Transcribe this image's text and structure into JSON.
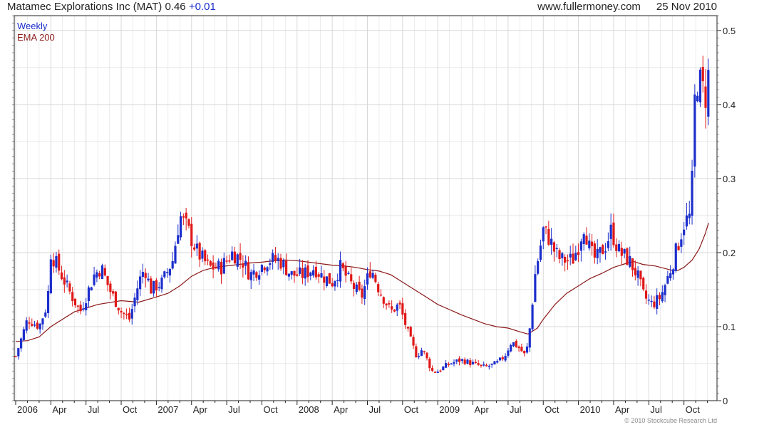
{
  "header": {
    "ticker_text": "Matamec Explorations Inc (MAT) 0.46",
    "change": "+0.01",
    "site": "www.fullermoney.com",
    "date": "25 Nov 2010"
  },
  "legend": {
    "series": "Weekly",
    "ema": "EMA 200"
  },
  "copyright": "© 2010 Stockcube Research Ltd",
  "colors": {
    "up": "#1c2ecc",
    "down": "#e01818",
    "ema": "#8b1a1a",
    "grid": "#d9d9d9",
    "frame": "#222222"
  },
  "chart_data": {
    "type": "candlestick",
    "frequency": "weekly",
    "title": "Matamec Explorations Inc (MAT) 0.46 +0.01",
    "ylim": [
      0,
      0.52
    ],
    "y_ticks": [
      "0",
      "0.1",
      "0.2",
      "0.3",
      "0.4",
      "0.5"
    ],
    "x_labels": [
      "2006",
      "Apr",
      "Jul",
      "Oct",
      "2007",
      "Apr",
      "Jul",
      "Oct",
      "2008",
      "Apr",
      "Jul",
      "Oct",
      "2009",
      "Apr",
      "Jul",
      "Oct",
      "2010",
      "Apr",
      "Jul",
      "Oct"
    ],
    "x_label_months": [
      0,
      3,
      6,
      9,
      12,
      15,
      18,
      21,
      24,
      27,
      30,
      33,
      36,
      39,
      42,
      45,
      48,
      51,
      54,
      57
    ],
    "grid": true,
    "price_anchors": [
      [
        0.0,
        0.06
      ],
      [
        0.3,
        0.075
      ],
      [
        1.0,
        0.11
      ],
      [
        2.0,
        0.1
      ],
      [
        2.7,
        0.13
      ],
      [
        3.0,
        0.2
      ],
      [
        3.6,
        0.18
      ],
      [
        4.5,
        0.15
      ],
      [
        5.5,
        0.12
      ],
      [
        6.0,
        0.14
      ],
      [
        6.7,
        0.17
      ],
      [
        7.3,
        0.18
      ],
      [
        8.0,
        0.15
      ],
      [
        9.0,
        0.12
      ],
      [
        9.7,
        0.11
      ],
      [
        10.5,
        0.16
      ],
      [
        11.0,
        0.18
      ],
      [
        11.5,
        0.15
      ],
      [
        12.5,
        0.16
      ],
      [
        13.4,
        0.19
      ],
      [
        14.0,
        0.25
      ],
      [
        14.7,
        0.23
      ],
      [
        15.5,
        0.2
      ],
      [
        16.5,
        0.18
      ],
      [
        17.5,
        0.18
      ],
      [
        18.5,
        0.2
      ],
      [
        19.3,
        0.19
      ],
      [
        20.0,
        0.17
      ],
      [
        20.8,
        0.18
      ],
      [
        21.5,
        0.19
      ],
      [
        22.5,
        0.19
      ],
      [
        23.5,
        0.17
      ],
      [
        24.5,
        0.17
      ],
      [
        25.5,
        0.18
      ],
      [
        26.0,
        0.17
      ],
      [
        27.0,
        0.16
      ],
      [
        27.7,
        0.18
      ],
      [
        28.5,
        0.16
      ],
      [
        29.5,
        0.14
      ],
      [
        30.3,
        0.18
      ],
      [
        31.0,
        0.15
      ],
      [
        32.0,
        0.12
      ],
      [
        32.7,
        0.13
      ],
      [
        33.5,
        0.09
      ],
      [
        34.2,
        0.06
      ],
      [
        34.7,
        0.07
      ],
      [
        35.5,
        0.04
      ],
      [
        36.0,
        0.04
      ],
      [
        37.0,
        0.05
      ],
      [
        38.0,
        0.055
      ],
      [
        39.0,
        0.05
      ],
      [
        40.0,
        0.045
      ],
      [
        41.0,
        0.05
      ],
      [
        41.7,
        0.06
      ],
      [
        42.3,
        0.08
      ],
      [
        43.0,
        0.07
      ],
      [
        43.5,
        0.06
      ],
      [
        43.8,
        0.09
      ],
      [
        44.3,
        0.17
      ],
      [
        45.0,
        0.23
      ],
      [
        45.5,
        0.22
      ],
      [
        46.0,
        0.2
      ],
      [
        46.5,
        0.19
      ],
      [
        47.5,
        0.19
      ],
      [
        48.0,
        0.21
      ],
      [
        48.5,
        0.24
      ],
      [
        49.0,
        0.2
      ],
      [
        49.5,
        0.19
      ],
      [
        50.3,
        0.21
      ],
      [
        50.8,
        0.23
      ],
      [
        51.5,
        0.2
      ],
      [
        52.3,
        0.19
      ],
      [
        53.0,
        0.17
      ],
      [
        53.6,
        0.14
      ],
      [
        54.3,
        0.13
      ],
      [
        55.0,
        0.14
      ],
      [
        55.7,
        0.17
      ],
      [
        56.3,
        0.2
      ],
      [
        57.0,
        0.24
      ],
      [
        57.6,
        0.25
      ],
      [
        58.0,
        0.44
      ],
      [
        58.3,
        0.43
      ],
      [
        58.8,
        0.41
      ],
      [
        59.1,
        0.44
      ]
    ],
    "ema_200": [
      [
        0.0,
        0.08
      ],
      [
        1.0,
        0.081
      ],
      [
        2.0,
        0.086
      ],
      [
        3.0,
        0.1
      ],
      [
        5.0,
        0.12
      ],
      [
        7.0,
        0.13
      ],
      [
        9.0,
        0.135
      ],
      [
        10.5,
        0.133
      ],
      [
        12.0,
        0.14
      ],
      [
        13.0,
        0.145
      ],
      [
        14.0,
        0.155
      ],
      [
        15.0,
        0.168
      ],
      [
        16.0,
        0.176
      ],
      [
        17.0,
        0.18
      ],
      [
        18.0,
        0.182
      ],
      [
        19.0,
        0.184
      ],
      [
        20.0,
        0.186
      ],
      [
        21.0,
        0.187
      ],
      [
        22.0,
        0.189
      ],
      [
        23.0,
        0.19
      ],
      [
        24.0,
        0.189
      ],
      [
        25.0,
        0.187
      ],
      [
        26.0,
        0.185
      ],
      [
        27.0,
        0.183
      ],
      [
        28.0,
        0.182
      ],
      [
        29.0,
        0.18
      ],
      [
        30.0,
        0.177
      ],
      [
        31.0,
        0.175
      ],
      [
        32.0,
        0.17
      ],
      [
        33.0,
        0.16
      ],
      [
        34.0,
        0.15
      ],
      [
        35.0,
        0.14
      ],
      [
        36.0,
        0.13
      ],
      [
        37.0,
        0.123
      ],
      [
        38.0,
        0.116
      ],
      [
        39.0,
        0.11
      ],
      [
        40.0,
        0.104
      ],
      [
        41.0,
        0.1
      ],
      [
        42.0,
        0.098
      ],
      [
        43.0,
        0.093
      ],
      [
        43.7,
        0.09
      ],
      [
        44.5,
        0.098
      ],
      [
        45.0,
        0.11
      ],
      [
        46.0,
        0.13
      ],
      [
        47.0,
        0.145
      ],
      [
        48.0,
        0.155
      ],
      [
        49.0,
        0.165
      ],
      [
        50.0,
        0.172
      ],
      [
        51.0,
        0.18
      ],
      [
        52.0,
        0.185
      ],
      [
        52.7,
        0.188
      ],
      [
        53.5,
        0.184
      ],
      [
        54.5,
        0.182
      ],
      [
        55.5,
        0.178
      ],
      [
        56.0,
        0.176
      ],
      [
        56.5,
        0.176
      ],
      [
        57.0,
        0.18
      ],
      [
        57.7,
        0.19
      ],
      [
        58.3,
        0.205
      ],
      [
        58.8,
        0.225
      ],
      [
        59.1,
        0.24
      ]
    ]
  }
}
